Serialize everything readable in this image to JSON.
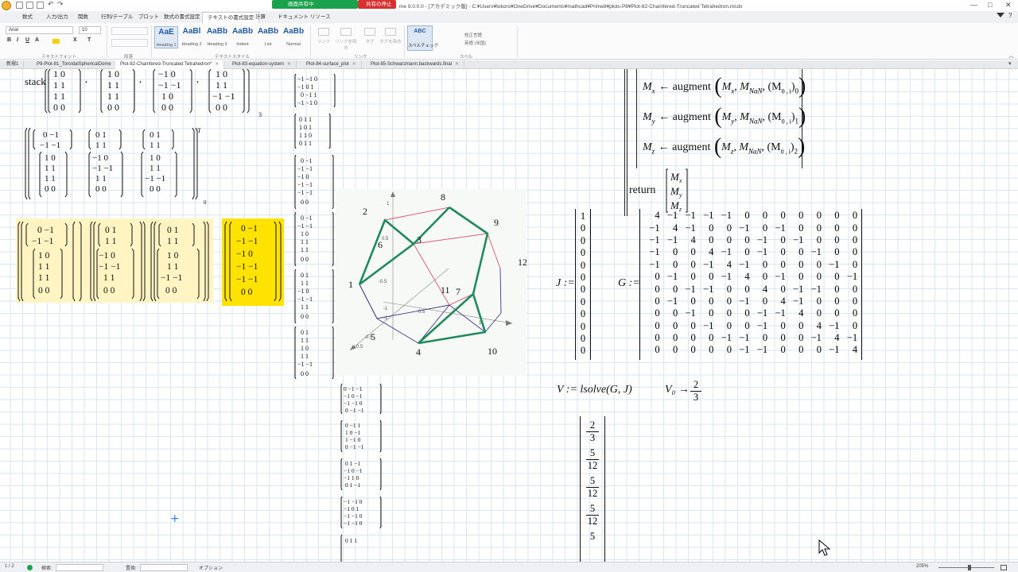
{
  "titlebar": {
    "share_label": "画面共有中",
    "stop_label": "共有の停止",
    "window_title": "me 9.0.0.0 - [アカデミック版] - C:¥Users¥tokoro¥OneDrive¥Documents¥mathcad¥Prime8¥plots-P8¥Plot-82-Chamfered-Truncated Tetrahedron.mcdx",
    "minimize": "—",
    "maximize": "□",
    "close": "✕",
    "help": "?"
  },
  "ribbon_tabs": [
    "数式",
    "入力/出力",
    "関数",
    "行列/テーブル",
    "プロット",
    "数式の書式設定",
    "テキストの書式設定",
    "計算",
    "ドキュメント",
    "リソース"
  ],
  "ribbon": {
    "font_name": "Arial",
    "font_size": "10",
    "groups": [
      "テキストフォント",
      "段落",
      "テキストスタイル",
      "リンク",
      "スペル"
    ],
    "styles": [
      {
        "aa": "AaE",
        "label": "Heading 1"
      },
      {
        "aa": "AaBl",
        "label": "Heading 2"
      },
      {
        "aa": "AaBb",
        "label": "Heading 3"
      },
      {
        "aa": "AaBb",
        "label": "Indent"
      },
      {
        "aa": "AaBb",
        "label": "List"
      },
      {
        "aa": "AaBb",
        "label": "Normal"
      }
    ],
    "link_buttons": [
      "リンク",
      "リンクを除去",
      "タグ",
      "タグを除去"
    ],
    "spell_label": "スペルチェック",
    "spell_lang_title": "校正言語",
    "spell_lang_value": "英語 (米国)",
    "spell_abc": "ABC"
  },
  "doc_tabs": [
    {
      "label": "新規1",
      "active": false
    },
    {
      "label": "P9-Plot-81_ToroidalSphericalDome",
      "active": false
    },
    {
      "label": "Plot-82-Chamfered-Truncated Tetrahedron*",
      "active": true
    },
    {
      "label": "Plot-83-equation-system",
      "active": false
    },
    {
      "label": "Plot-84-surface_plot",
      "active": false
    },
    {
      "label": "Plot-85-Schwarzmann.backwards.final",
      "active": false
    }
  ],
  "worksheet": {
    "stack_label": "stack",
    "plot_labels": [
      "1",
      "2",
      "3",
      "4",
      "5",
      "6",
      "7",
      "8",
      "9",
      "10",
      "11",
      "12"
    ],
    "plot_axis_ticks": [
      "1",
      "0.5",
      "-0.5",
      "-1",
      "0.5",
      "1",
      "-1",
      "-0.5",
      "0.5"
    ],
    "J_label": "J :=",
    "G_label": "G :=",
    "J_values": [
      "1",
      "0",
      "0",
      "0",
      "0",
      "0",
      "0",
      "0",
      "0",
      "0",
      "0",
      "0"
    ],
    "G_rows": [
      [
        "4",
        "−1",
        "−1",
        "−1",
        "−1",
        "0",
        "0",
        "0",
        "0",
        "0",
        "0",
        "0"
      ],
      [
        "−1",
        "4",
        "−1",
        "0",
        "0",
        "−1",
        "0",
        "−1",
        "0",
        "0",
        "0",
        "0"
      ],
      [
        "−1",
        "−1",
        "4",
        "0",
        "0",
        "0",
        "−1",
        "0",
        "−1",
        "0",
        "0",
        "0"
      ],
      [
        "−1",
        "0",
        "0",
        "4",
        "−1",
        "0",
        "−1",
        "0",
        "0",
        "−1",
        "0",
        "0"
      ],
      [
        "−1",
        "0",
        "0",
        "−1",
        "4",
        "−1",
        "0",
        "0",
        "0",
        "0",
        "−1",
        "0"
      ],
      [
        "0",
        "−1",
        "0",
        "0",
        "−1",
        "4",
        "0",
        "−1",
        "0",
        "0",
        "0",
        "−1"
      ],
      [
        "0",
        "0",
        "−1",
        "−1",
        "0",
        "0",
        "4",
        "0",
        "−1",
        "−1",
        "0",
        "0"
      ],
      [
        "0",
        "−1",
        "0",
        "0",
        "0",
        "−1",
        "0",
        "4",
        "−1",
        "0",
        "0",
        "0"
      ],
      [
        "0",
        "0",
        "−1",
        "0",
        "0",
        "0",
        "−1",
        "−1",
        "4",
        "0",
        "0",
        "0"
      ],
      [
        "0",
        "0",
        "0",
        "−1",
        "0",
        "0",
        "−1",
        "0",
        "0",
        "4",
        "−1",
        "0"
      ],
      [
        "0",
        "0",
        "0",
        "0",
        "−1",
        "−1",
        "0",
        "0",
        "0",
        "−1",
        "4",
        "−1"
      ],
      [
        "0",
        "0",
        "0",
        "0",
        "0",
        "−1",
        "−1",
        "0",
        "0",
        "0",
        "−1",
        "4"
      ]
    ],
    "V_def": "V := lsolve(G, J)",
    "V0_eval": "V₀ →",
    "V0_num": "2",
    "V0_den": "3",
    "V_vec": [
      {
        "num": "2",
        "den": "3"
      },
      {
        "num": "5",
        "den": "12"
      },
      {
        "num": "5",
        "den": "12"
      },
      {
        "num": "5",
        "den": "12"
      },
      {
        "num": "5",
        "den": ""
      }
    ],
    "augment_lines": [
      {
        "lhs": "M",
        "sub": "x",
        "func": "← augment",
        "arg1": "M",
        "arg1sub": "x",
        "arg2": "M",
        "arg2sub": "NaN",
        "idx": "0"
      },
      {
        "lhs": "M",
        "sub": "y",
        "func": "← augment",
        "arg1": "M",
        "arg1sub": "y",
        "arg2": "M",
        "arg2sub": "NaN",
        "idx": "1"
      },
      {
        "lhs": "M",
        "sub": "z",
        "func": "← augment",
        "arg1": "M",
        "arg1sub": "z",
        "arg2": "M",
        "arg2sub": "NaN",
        "idx": "2"
      }
    ],
    "return_label": "return",
    "return_vec": [
      "Mx",
      "My",
      "Mz"
    ]
  },
  "statusbar": {
    "page": "1 / 2",
    "find_label": "検索:",
    "replace_label": "置換:",
    "options_label": "オプション",
    "zoom": "205%"
  },
  "colors": {
    "share_green": "#1aa14b",
    "stop_red": "#d73030",
    "highlight_yellow": "#fff4c2",
    "highlight_strong": "#ffe300",
    "plot_green": "#1f8a5b",
    "plot_red": "#d9607a",
    "plot_navy": "#3a3a8a"
  }
}
